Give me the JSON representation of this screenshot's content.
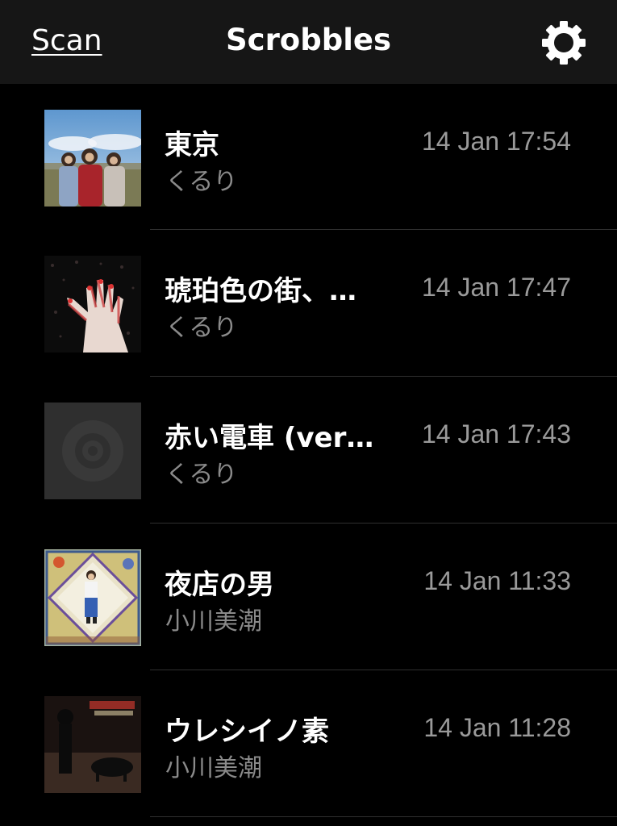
{
  "navbar": {
    "left_button": "Scan",
    "title": "Scrobbles",
    "right_icon": "gear-icon"
  },
  "colors": {
    "background": "#000000",
    "navbar_background": "#161616",
    "primary_text": "#ffffff",
    "secondary_text": "#8a8a8a",
    "separator": "#2f2f2f"
  },
  "scrobbles": [
    {
      "title": "東京",
      "artist": "くるり",
      "time": "14 Jan 17:54",
      "artwork": "band-photo-sky"
    },
    {
      "title": "琥珀色の街、…",
      "artist": "くるり",
      "time": "14 Jan 17:47",
      "artwork": "hand-painting"
    },
    {
      "title": "赤い電車 (ver…",
      "artist": "くるり",
      "time": "14 Jan 17:43",
      "artwork": "placeholder-disc"
    },
    {
      "title": "夜店の男",
      "artist": "小川美潮",
      "time": "14 Jan 11:33",
      "artwork": "illustrated-figure"
    },
    {
      "title": "ウレシイノ素",
      "artist": "小川美潮",
      "time": "14 Jan 11:28",
      "artwork": "dark-figure-pig"
    }
  ]
}
